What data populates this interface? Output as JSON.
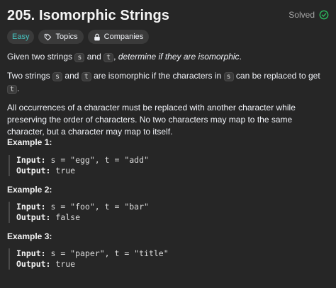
{
  "problem": {
    "title": "205. Isomorphic Strings",
    "status": "Solved",
    "tags": {
      "difficulty": "Easy",
      "topics": "Topics",
      "companies": "Companies"
    }
  },
  "description": {
    "p1_a": "Given two strings ",
    "p1_s": "s",
    "p1_b": " and ",
    "p1_t": "t",
    "p1_c": ", ",
    "p1_em": "determine if they are isomorphic",
    "p1_d": ".",
    "p2_a": "Two strings ",
    "p2_s": "s",
    "p2_b": " and ",
    "p2_t": "t",
    "p2_c": " are isomorphic if the characters in ",
    "p2_s2": "s",
    "p2_d": " can be replaced to get ",
    "p2_t2": "t",
    "p2_e": ".",
    "p3": "All occurrences of a character must be replaced with another character while preserving the order of characters. No two characters may map to the same character, but a character may map to itself."
  },
  "examples": [
    {
      "title": "Example 1:",
      "input_label": "Input:",
      "input": " s = \"egg\", t = \"add\"",
      "output_label": "Output:",
      "output": " true"
    },
    {
      "title": "Example 2:",
      "input_label": "Input:",
      "input": " s = \"foo\", t = \"bar\"",
      "output_label": "Output:",
      "output": " false"
    },
    {
      "title": "Example 3:",
      "input_label": "Input:",
      "input": " s = \"paper\", t = \"title\"",
      "output_label": "Output:",
      "output": " true"
    }
  ],
  "colors": {
    "background": "#262626",
    "easy": "#46c6c2",
    "solved_check": "#2cbb5d"
  }
}
